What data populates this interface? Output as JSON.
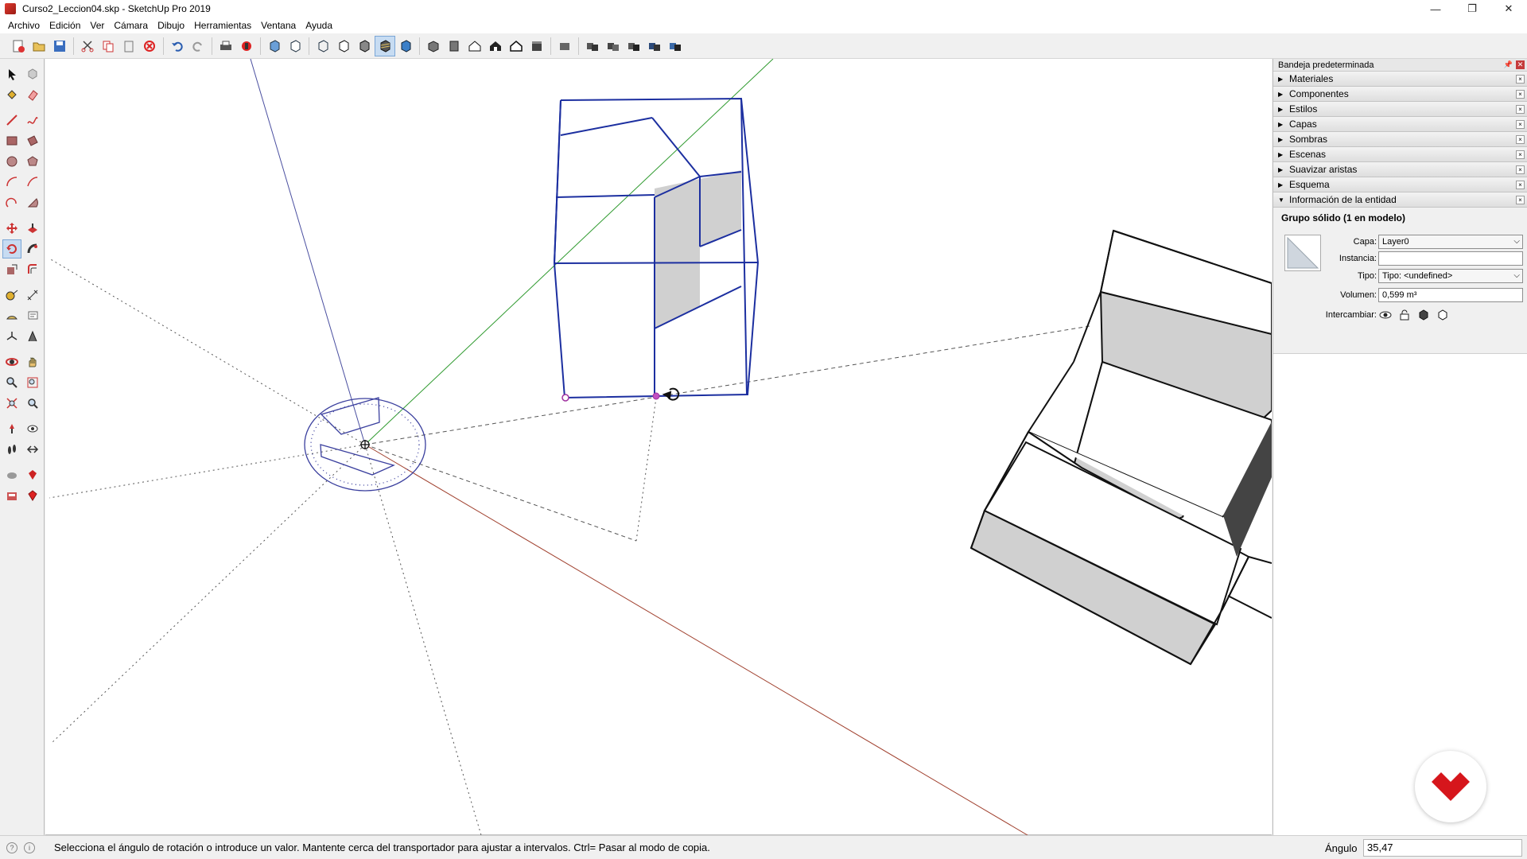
{
  "window": {
    "title": "Curso2_Leccion04.skp - SketchUp Pro 2019",
    "controls": [
      "—",
      "❐",
      "✕"
    ]
  },
  "menu": [
    "Archivo",
    "Edición",
    "Ver",
    "Cámara",
    "Dibujo",
    "Herramientas",
    "Ventana",
    "Ayuda"
  ],
  "tray": {
    "title": "Bandeja predeterminada",
    "panels": [
      "Materiales",
      "Componentes",
      "Estilos",
      "Capas",
      "Sombras",
      "Escenas",
      "Suavizar aristas",
      "Esquema"
    ],
    "entity_info": {
      "header": "Información de la entidad",
      "title": "Grupo sólido (1 en modelo)",
      "layer_label": "Capa:",
      "layer_value": "Layer0",
      "instance_label": "Instancia:",
      "instance_value": "",
      "type_label": "Tipo:",
      "type_value": "Tipo: <undefined>",
      "volume_label": "Volumen:",
      "volume_value": "0,599 m³",
      "toggle_label": "Intercambiar:"
    }
  },
  "status": {
    "message": "Selecciona el ángulo de rotación o introduce un valor. Mantente cerca del transportador para ajustar a intervalos. Ctrl= Pasar al modo de copia.",
    "measure_label": "Ángulo",
    "measure_value": "35,47"
  },
  "colors": {
    "selection_blue": "#1c2fa0",
    "axis_green": "#2e9a2e",
    "axis_red": "#a0402e",
    "protractor": "#3a3f9e",
    "face_gray": "#d0d0d0",
    "logo_red": "#d6161c"
  }
}
